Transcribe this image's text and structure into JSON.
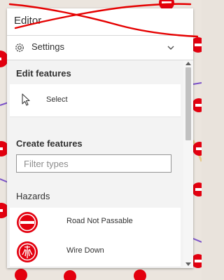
{
  "header": {
    "title": "Editor"
  },
  "settings": {
    "label": "Settings",
    "icon": "gear-icon",
    "toggle_icon": "chevron-down-icon"
  },
  "edit_features": {
    "title": "Edit features",
    "select": {
      "label": "Select",
      "icon": "cursor-arrow-icon"
    }
  },
  "create_features": {
    "title": "Create features",
    "filter": {
      "placeholder": "Filter types",
      "value": ""
    }
  },
  "hazards": {
    "title": "Hazards",
    "items": [
      {
        "label": "Road Not Passable",
        "icon": "road-not-passable-icon"
      },
      {
        "label": "Wire Down",
        "icon": "wire-down-icon"
      }
    ]
  },
  "colors": {
    "accent_red": "#e3000f",
    "annotation_red": "#e50000",
    "panel_bg": "#f3f3f3",
    "text": "#323232"
  }
}
